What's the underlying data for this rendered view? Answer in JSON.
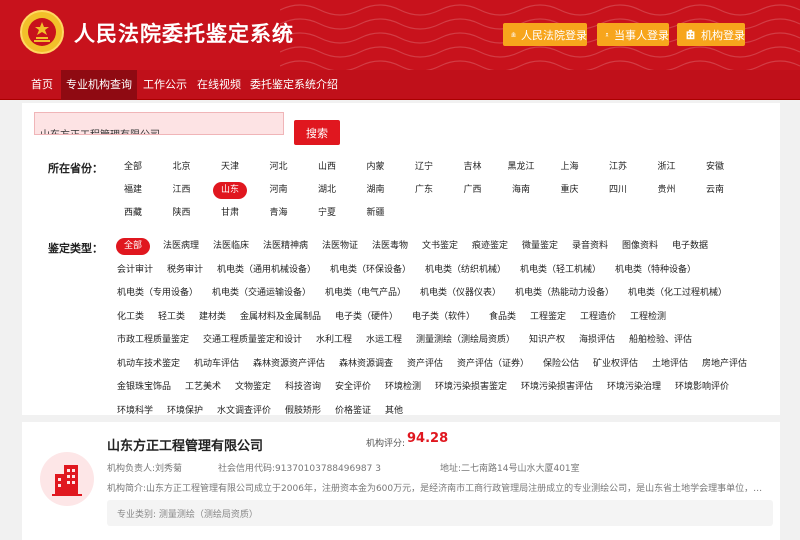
{
  "header": {
    "title": "人民法院委托鉴定系统",
    "buttons": [
      {
        "label": "人民法院登录",
        "icon": "court-building-icon"
      },
      {
        "label": "当事人登录",
        "icon": "person-icon"
      },
      {
        "label": "机构登录",
        "icon": "institution-icon"
      }
    ]
  },
  "nav": {
    "items": [
      {
        "label": "首页",
        "active": false
      },
      {
        "label": "专业机构查询",
        "active": true
      },
      {
        "label": "工作公示",
        "active": false
      },
      {
        "label": "在线视频",
        "active": false
      },
      {
        "label": "委托鉴定系统介绍",
        "active": false
      }
    ]
  },
  "search": {
    "value": "山东方正工程管理有限公司",
    "button_label": "搜索"
  },
  "province": {
    "label": "所在省份：",
    "selected": "山东",
    "rows": [
      [
        "全部",
        "北京",
        "天津",
        "河北",
        "山西",
        "内蒙",
        "辽宁",
        "吉林",
        "黑龙江",
        "上海",
        "江苏",
        "浙江",
        "安徽"
      ],
      [
        "福建",
        "江西",
        "山东",
        "河南",
        "湖北",
        "湖南",
        "广东",
        "广西",
        "海南",
        "重庆",
        "四川",
        "贵州",
        "云南"
      ],
      [
        "西藏",
        "陕西",
        "甘肃",
        "青海",
        "宁夏",
        "新疆"
      ]
    ]
  },
  "category": {
    "label": "鉴定类型：",
    "selected": "全部",
    "rows": [
      [
        "全部",
        "法医病理",
        "法医临床",
        "法医精神病",
        "法医物证",
        "法医毒物",
        "文书鉴定",
        "痕迹鉴定",
        "微量鉴定",
        "录音资料",
        "图像资料",
        "电子数据"
      ],
      [
        "会计审计",
        "税务审计",
        "机电类（通用机械设备）",
        "机电类（环保设备）",
        "机电类（纺织机械）",
        "机电类（轻工机械）",
        "机电类（特种设备）"
      ],
      [
        "机电类（专用设备）",
        "机电类（交通运输设备）",
        "机电类（电气产品）",
        "机电类（仪器仪表）",
        "机电类（热能动力设备）",
        "机电类（化工过程机械）"
      ],
      [
        "化工类",
        "轻工类",
        "建材类",
        "金属材料及金属制品",
        "电子类（硬件）",
        "电子类（软件）",
        "食品类",
        "工程鉴定",
        "工程造价",
        "工程检测"
      ],
      [
        "市政工程质量鉴定",
        "交通工程质量鉴定和设计",
        "水利工程",
        "水运工程",
        "测量测绘（测绘局资质）",
        "知识产权",
        "海损评估",
        "船舶检验、评估"
      ],
      [
        "机动车技术鉴定",
        "机动车评估",
        "森林资源资产评估",
        "森林资源调查",
        "资产评估",
        "资产评估（证券）",
        "保险公估",
        "矿业权评估",
        "土地评估",
        "房地产评估"
      ],
      [
        "金银珠宝饰品",
        "工艺美术",
        "文物鉴定",
        "科技咨询",
        "安全评价",
        "环境检测",
        "环境污染损害鉴定",
        "环境污染损害评估",
        "环境污染治理",
        "环境影响评价"
      ],
      [
        "环境科学",
        "环境保护",
        "水文调查评价",
        "假肢矫形",
        "价格鉴证",
        "其他"
      ]
    ]
  },
  "result": {
    "name": "山东方正工程管理有限公司",
    "score_label": "机构评分:",
    "score": "94.28",
    "leader": "机构负责人:刘秀菊",
    "credit_code": "社会信用代码:91370103788496987 3",
    "address": "地址:二七南路14号山水大厦401室",
    "intro": "机构简介:山东方正工程管理有限公司成立于2006年，注册资本金为600万元，是经济南市工商行政管理局注册成立的专业测绘公司，是山东省土地学会理事单位，山东省测绘",
    "category_text": "专业类别:   测量测绘（测绘局资质）"
  },
  "colors": {
    "primary": "#c8121c",
    "accent": "#f7a51c",
    "selected": "#e0171f"
  }
}
